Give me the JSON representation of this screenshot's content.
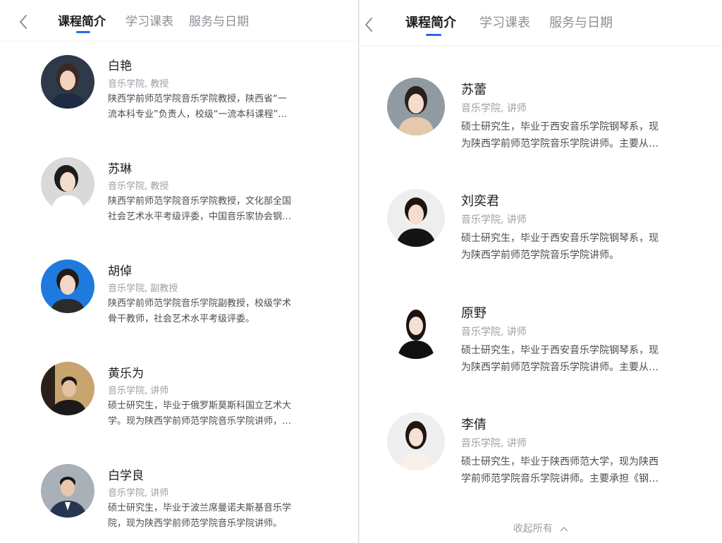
{
  "nav": {
    "tabs": [
      "课程简介",
      "学习课表",
      "服务与日期"
    ],
    "active_tab": 0
  },
  "left_teachers": [
    {
      "name": "白艳",
      "title": "音乐学院, 教授",
      "bio_line1": "陕西学前师范学院音乐学院教授，陕西省“一",
      "bio_line2": "流本科专业”负责人，校级“一流本科课程”…",
      "avatar_bg": "#2e3a4a",
      "avatar_shirt": "#1d2b44"
    },
    {
      "name": "苏琳",
      "title": "音乐学院, 教授",
      "bio_line1": "陕西学前师范学院音乐学院教授，文化部全国",
      "bio_line2": "社会艺术水平考级评委，中国音乐家协会钢…",
      "avatar_bg": "#d9d9d9",
      "avatar_shirt": "#ffffff"
    },
    {
      "name": "胡倬",
      "title": "音乐学院, 副教授",
      "bio_line1": "陕西学前师范学院音乐学院副教授，校级学术",
      "bio_line2": "骨干教师，社会艺术水平考级评委。",
      "avatar_bg": "#1f7ae0",
      "avatar_shirt": "#2b2b2b"
    },
    {
      "name": "黄乐为",
      "title": "音乐学院, 讲师",
      "bio_line1": "硕士研究生，毕业于俄罗斯莫斯科国立艺术大",
      "bio_line2": "学。现为陕西学前师范学院音乐学院讲师，…",
      "avatar_bg": "#c8a46e",
      "avatar_shirt": "#1a1a1a"
    },
    {
      "name": "白学良",
      "title": "音乐学院, 讲师",
      "bio_line1": "硕士研究生，毕业于波兰席曼诺夫斯基音乐学",
      "bio_line2": "院，现为陕西学前师范学院音乐学院讲师。",
      "avatar_bg": "#a9b0b8",
      "avatar_shirt": "#283552"
    }
  ],
  "right_teachers": [
    {
      "name": "苏蕾",
      "title": "音乐学院, 讲师",
      "bio_line1": "硕士研究生，毕业于西安音乐学院钢琴系，现",
      "bio_line2": "为陕西学前师范学院音乐学院讲师。主要从…",
      "avatar_bg": "#8f9aa2",
      "avatar_shirt": "#e6c9ad"
    },
    {
      "name": "刘奕君",
      "title": "音乐学院, 讲师",
      "bio_line1": "硕士研究生，毕业于西安音乐学院钢琴系，现",
      "bio_line2": "为陕西学前师范学院音乐学院讲师。",
      "avatar_bg": "#eeeeee",
      "avatar_shirt": "#141414"
    },
    {
      "name": "原野",
      "title": "音乐学院, 讲师",
      "bio_line1": "硕士研究生，毕业于西安音乐学院钢琴系，现",
      "bio_line2": "为陕西学前师范学院音乐学院讲师。主要从…",
      "avatar_bg": "#ffffff",
      "avatar_shirt": "#111111"
    },
    {
      "name": "李倩",
      "title": "音乐学院, 讲师",
      "bio_line1": "硕士研究生，毕业于陕西师范大学，现为陕西",
      "bio_line2": "学前师范学院音乐学院讲师。主要承担《钢…",
      "avatar_bg": "#efefef",
      "avatar_shirt": "#f7f1ea"
    }
  ],
  "collapse_label": "收起所有",
  "colors": {
    "accent": "#2a66f2",
    "muted": "#9aa0a6"
  }
}
